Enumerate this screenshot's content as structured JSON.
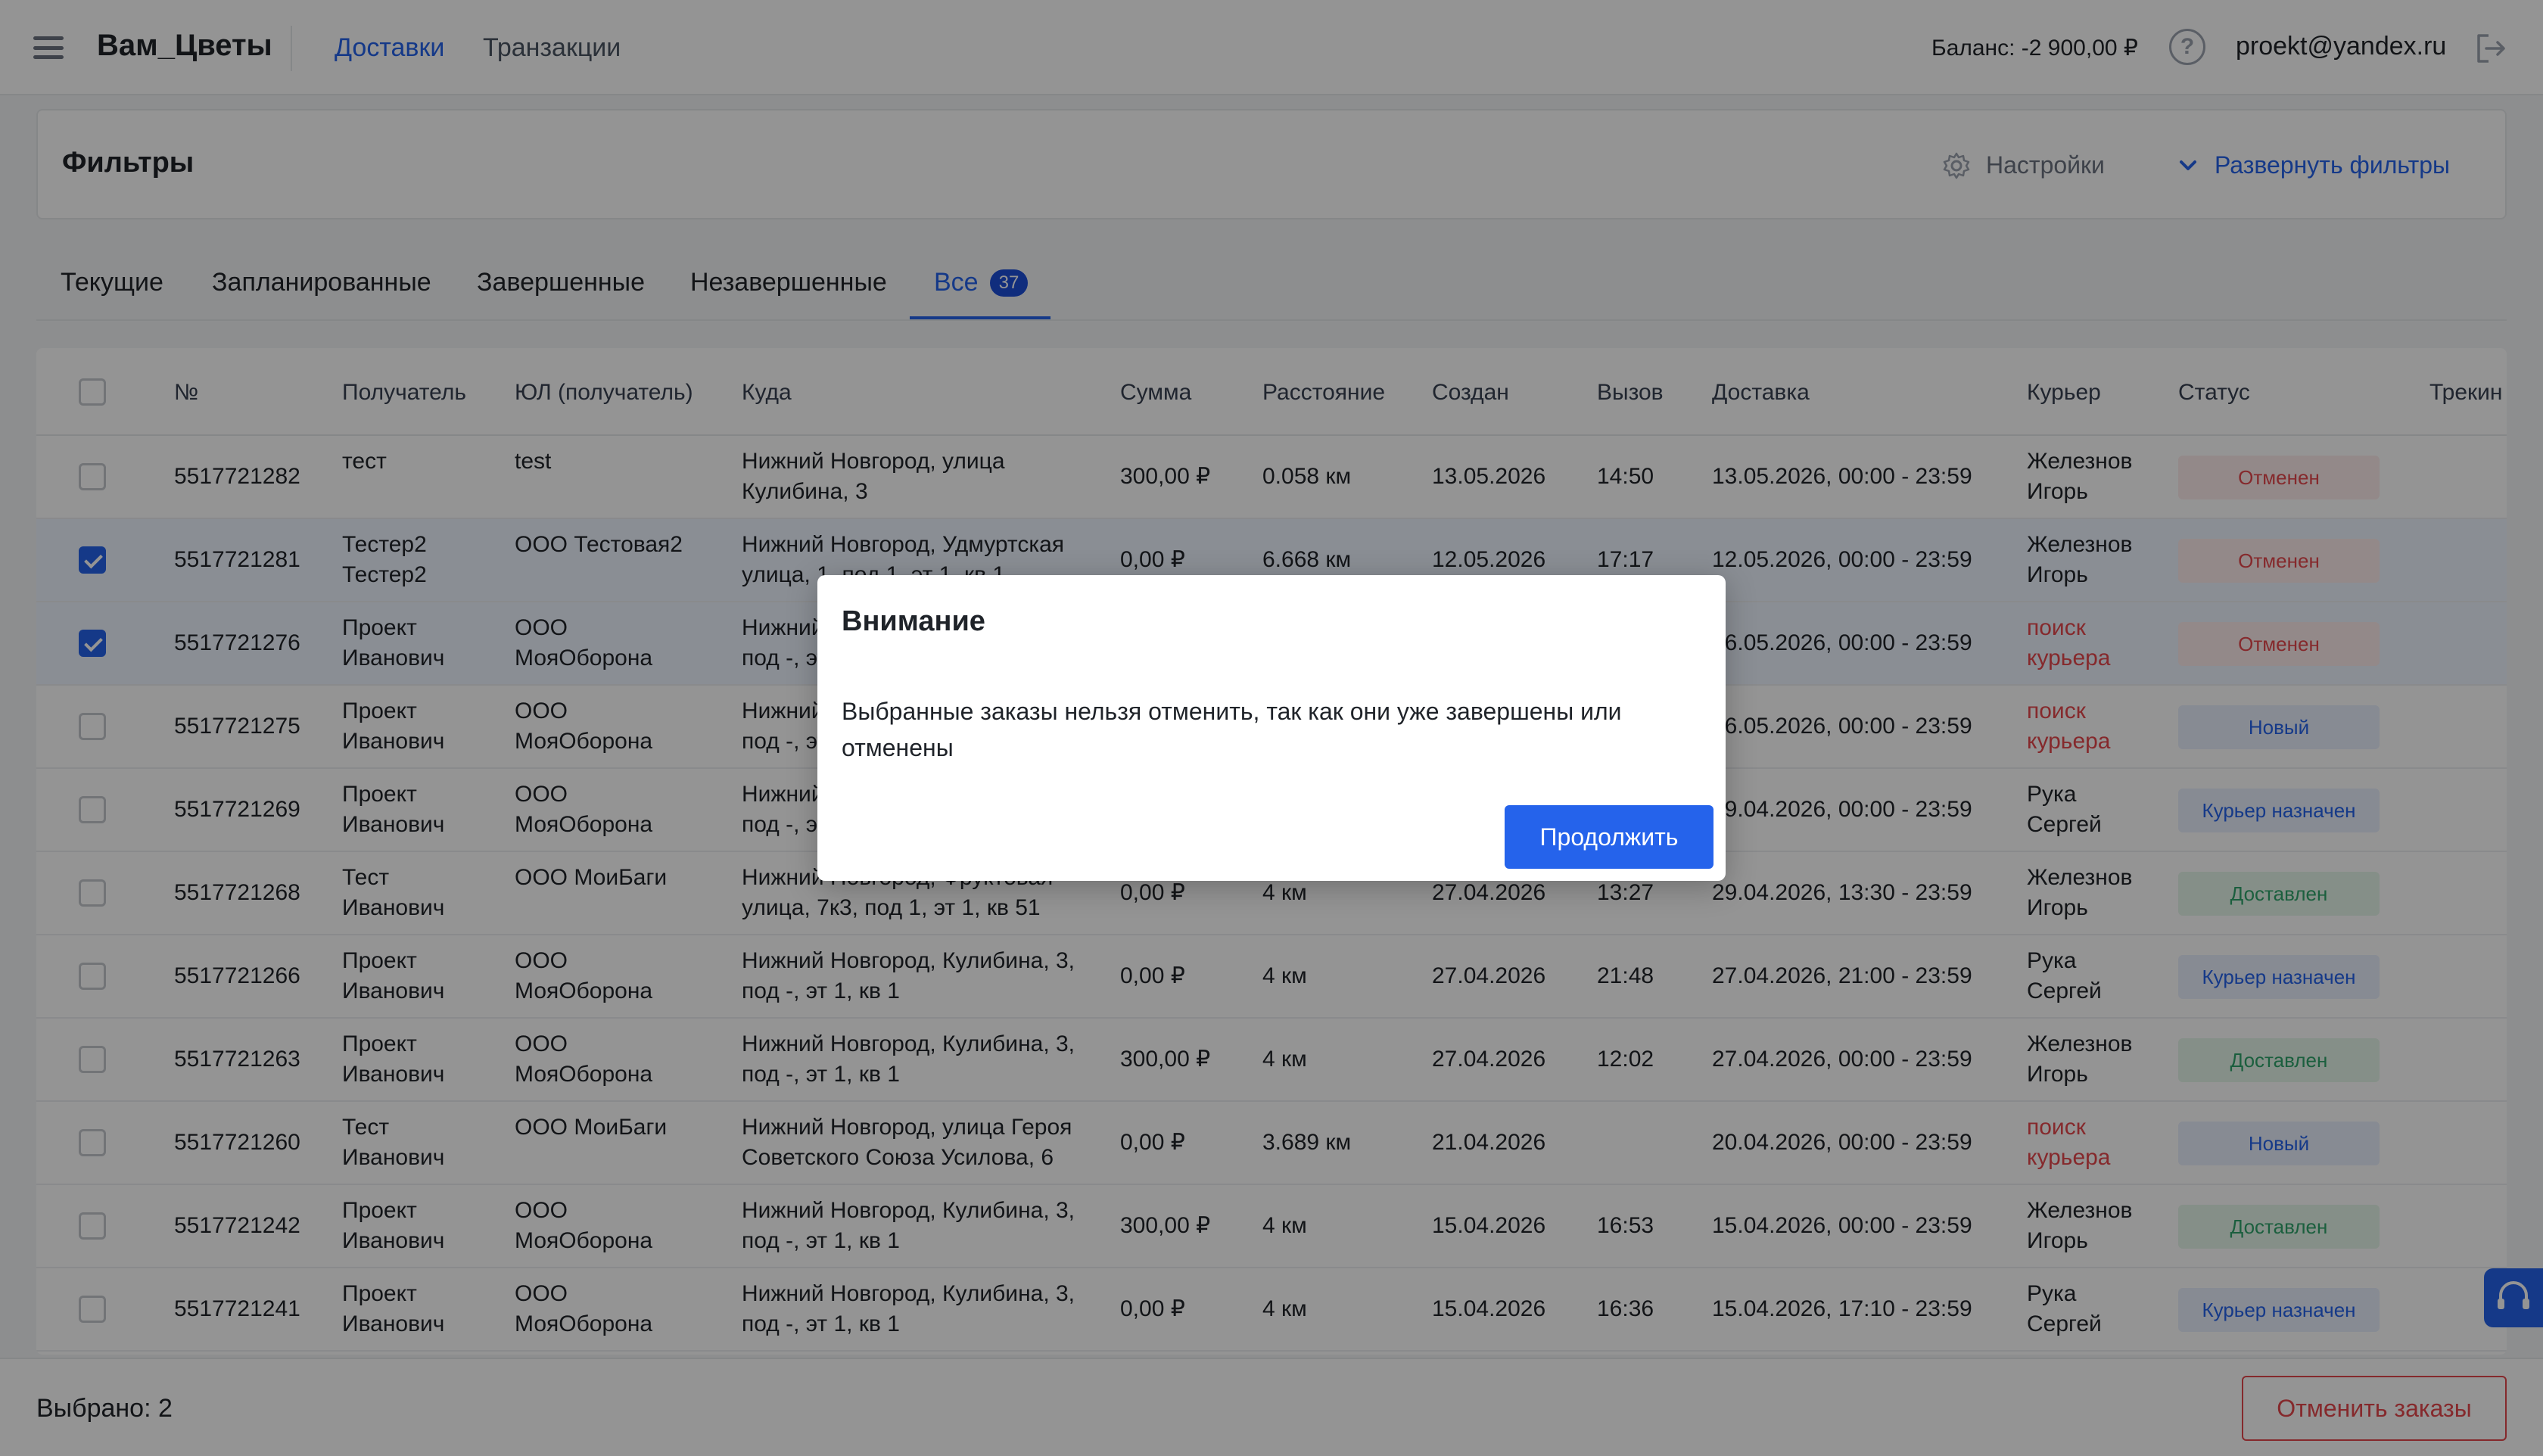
{
  "header": {
    "brand": "Вам_Цветы",
    "nav": [
      "Доставки",
      "Транзакции"
    ],
    "balance": "Баланс: -2 900,00 ₽",
    "help_icon_glyph": "?",
    "user_email": "proekt@yandex.ru"
  },
  "filters": {
    "title": "Фильтры",
    "settings_label": "Настройки",
    "expand_label": "Развернуть фильтры"
  },
  "tabs": {
    "items": [
      "Текущие",
      "Запланированные",
      "Завершенные",
      "Незавершенные",
      "Все"
    ],
    "active": "Все",
    "all_count": "37"
  },
  "table": {
    "columns": [
      "№",
      "Получатель",
      "ЮЛ (получатель)",
      "Куда",
      "Сумма",
      "Расстояние",
      "Создан",
      "Вызов",
      "Доставка",
      "Курьер",
      "Статус",
      "Трекин"
    ],
    "rows": [
      {
        "checked": false,
        "num": "5517721282",
        "recipient": "тест",
        "company": "test",
        "address": "Нижний Новгород, улица Кулибина, 3",
        "sum": "300,00 ₽",
        "distance": "0.058 км",
        "created": "13.05.2026",
        "call": "14:50",
        "delivery": "13.05.2026, 00:00 - 23:59",
        "courier": "Железнов Игорь",
        "courier_red": false,
        "status": "Отменен",
        "status_type": "cancelled"
      },
      {
        "checked": true,
        "num": "5517721281",
        "recipient": "Тестер2 Тестер2",
        "company": "ООО Тестовая2",
        "address": "Нижний Новгород, Удмуртская улица, 1, под 1, эт 1, кв 1",
        "sum": "0,00 ₽",
        "distance": "6.668 км",
        "created": "12.05.2026",
        "call": "17:17",
        "delivery": "12.05.2026, 00:00 - 23:59",
        "courier": "Железнов Игорь",
        "courier_red": false,
        "status": "Отменен",
        "status_type": "cancelled"
      },
      {
        "checked": true,
        "num": "5517721276",
        "recipient": "Проект Иванович",
        "company": "ООО МояОборона",
        "address": "Нижний Новгород, Кулибина, 3, под -, эт 1, кв 1",
        "sum": "",
        "distance": "",
        "created": "",
        "call": "",
        "delivery": "16.05.2026, 00:00 - 23:59",
        "courier": "поиск курьера",
        "courier_red": true,
        "status": "Отменен",
        "status_type": "cancelled"
      },
      {
        "checked": false,
        "num": "5517721275",
        "recipient": "Проект Иванович",
        "company": "ООО МояОборона",
        "address": "Нижний Новгород, Кулибина, 3, под -, эт 1, кв 1",
        "sum": "",
        "distance": "",
        "created": "",
        "call": "",
        "delivery": "16.05.2026, 00:00 - 23:59",
        "courier": "поиск курьера",
        "courier_red": true,
        "status": "Новый",
        "status_type": "new"
      },
      {
        "checked": false,
        "num": "5517721269",
        "recipient": "Проект Иванович",
        "company": "ООО МояОборона",
        "address": "Нижний Новгород, Кулибина, 3, под -, эт 1, кв 1",
        "sum": "",
        "distance": "",
        "created": "",
        "call": "",
        "delivery": "29.04.2026, 00:00 - 23:59",
        "courier": "Рука Сергей",
        "courier_red": false,
        "status": "Курьер назначен",
        "status_type": "assigned"
      },
      {
        "checked": false,
        "num": "5517721268",
        "recipient": "Тест Иванович",
        "company": "ООО МоиБаги",
        "address": "Нижний Новгород, Фруктовая улица, 7к3, под 1, эт 1, кв 51",
        "sum": "0,00 ₽",
        "distance": "4 км",
        "created": "27.04.2026",
        "call": "13:27",
        "delivery": "29.04.2026, 13:30 - 23:59",
        "courier": "Железнов Игорь",
        "courier_red": false,
        "status": "Доставлен",
        "status_type": "delivered"
      },
      {
        "checked": false,
        "num": "5517721266",
        "recipient": "Проект Иванович",
        "company": "ООО МояОборона",
        "address": "Нижний Новгород, Кулибина, 3, под -, эт 1, кв 1",
        "sum": "0,00 ₽",
        "distance": "4 км",
        "created": "27.04.2026",
        "call": "21:48",
        "delivery": "27.04.2026, 21:00 - 23:59",
        "courier": "Рука Сергей",
        "courier_red": false,
        "status": "Курьер назначен",
        "status_type": "assigned"
      },
      {
        "checked": false,
        "num": "5517721263",
        "recipient": "Проект Иванович",
        "company": "ООО МояОборона",
        "address": "Нижний Новгород, Кулибина, 3, под -, эт 1, кв 1",
        "sum": "300,00 ₽",
        "distance": "4 км",
        "created": "27.04.2026",
        "call": "12:02",
        "delivery": "27.04.2026, 00:00 - 23:59",
        "courier": "Железнов Игорь",
        "courier_red": false,
        "status": "Доставлен",
        "status_type": "delivered"
      },
      {
        "checked": false,
        "num": "5517721260",
        "recipient": "Тест Иванович",
        "company": "ООО МоиБаги",
        "address": "Нижний Новгород, улица Героя Советского Союза Усилова, 6",
        "sum": "0,00 ₽",
        "distance": "3.689 км",
        "created": "21.04.2026",
        "call": "",
        "delivery": "20.04.2026, 00:00 - 23:59",
        "courier": "поиск курьера",
        "courier_red": true,
        "status": "Новый",
        "status_type": "new"
      },
      {
        "checked": false,
        "num": "5517721242",
        "recipient": "Проект Иванович",
        "company": "ООО МояОборона",
        "address": "Нижний Новгород, Кулибина, 3, под -, эт 1, кв 1",
        "sum": "300,00 ₽",
        "distance": "4 км",
        "created": "15.04.2026",
        "call": "16:53",
        "delivery": "15.04.2026, 00:00 - 23:59",
        "courier": "Железнов Игорь",
        "courier_red": false,
        "status": "Доставлен",
        "status_type": "delivered"
      },
      {
        "checked": false,
        "num": "5517721241",
        "recipient": "Проект Иванович",
        "company": "ООО МояОборона",
        "address": "Нижний Новгород, Кулибина, 3, под -, эт 1, кв 1",
        "sum": "0,00 ₽",
        "distance": "4 км",
        "created": "15.04.2026",
        "call": "16:36",
        "delivery": "15.04.2026, 17:10 - 23:59",
        "courier": "Рука Сергей",
        "courier_red": false,
        "status": "Курьер назначен",
        "status_type": "assigned"
      }
    ]
  },
  "bottom": {
    "selected_label": "Выбрано: 2",
    "cancel_orders_label": "Отменить заказы"
  },
  "modal": {
    "title": "Внимание",
    "text": "Выбранные заказы нельзя отменить, так как они уже завершены или отменены",
    "continue_label": "Продолжить"
  },
  "colors": {
    "accent": "#2563eb",
    "danger": "#e5484d",
    "success": "#30a46c"
  },
  "icons": [
    "menu-icon",
    "help-icon",
    "logout-icon",
    "gear-icon",
    "chevron-down-icon",
    "support-icon"
  ]
}
